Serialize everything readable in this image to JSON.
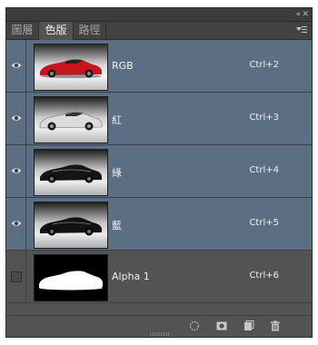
{
  "topbar": {
    "collapse_icon": "«",
    "close_icon": "✕"
  },
  "tabs": [
    {
      "label": "圖層",
      "active": false
    },
    {
      "label": "色版",
      "active": true
    },
    {
      "label": "路徑",
      "active": false
    }
  ],
  "panel_menu_icon": "panel-menu-icon",
  "channels": [
    {
      "name": "RGB",
      "shortcut": "Ctrl+2",
      "visible": true,
      "selected": true,
      "thumb": "color"
    },
    {
      "name": "紅",
      "shortcut": "Ctrl+3",
      "visible": true,
      "selected": true,
      "thumb": "red"
    },
    {
      "name": "綠",
      "shortcut": "Ctrl+4",
      "visible": true,
      "selected": true,
      "thumb": "green"
    },
    {
      "name": "藍",
      "shortcut": "Ctrl+5",
      "visible": true,
      "selected": true,
      "thumb": "blue"
    },
    {
      "name": "Alpha 1",
      "shortcut": "Ctrl+6",
      "visible": false,
      "selected": false,
      "thumb": "alpha"
    }
  ],
  "bottom_icons": [
    "load-selection-icon",
    "save-selection-icon",
    "new-channel-icon",
    "trash-icon"
  ],
  "colors": {
    "selected_row": "#5c6e84",
    "panel_bg": "#535353",
    "car_red": "#c8141c"
  }
}
